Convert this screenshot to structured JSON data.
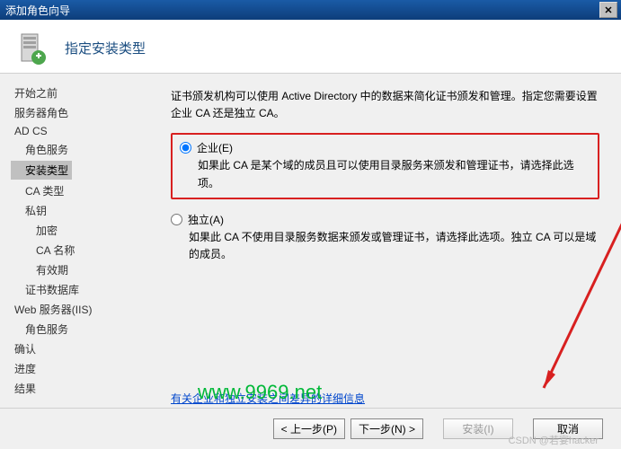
{
  "window": {
    "title": "添加角色向导"
  },
  "header": {
    "title": "指定安装类型"
  },
  "sidebar": {
    "items": [
      {
        "label": "开始之前",
        "indent": 0
      },
      {
        "label": "服务器角色",
        "indent": 0
      },
      {
        "label": "AD CS",
        "indent": 0
      },
      {
        "label": "角色服务",
        "indent": 1
      },
      {
        "label": "安装类型",
        "indent": 1,
        "selected": true
      },
      {
        "label": "CA 类型",
        "indent": 1
      },
      {
        "label": "私钥",
        "indent": 1
      },
      {
        "label": "加密",
        "indent": 2
      },
      {
        "label": "CA 名称",
        "indent": 2
      },
      {
        "label": "有效期",
        "indent": 2
      },
      {
        "label": "证书数据库",
        "indent": 1
      },
      {
        "label": "Web 服务器(IIS)",
        "indent": 0
      },
      {
        "label": "角色服务",
        "indent": 1
      },
      {
        "label": "确认",
        "indent": 0
      },
      {
        "label": "进度",
        "indent": 0
      },
      {
        "label": "结果",
        "indent": 0
      }
    ]
  },
  "content": {
    "intro": "证书颁发机构可以使用 Active Directory 中的数据来简化证书颁发和管理。指定您需要设置企业 CA 还是独立 CA。",
    "options": [
      {
        "title": "企业(E)",
        "desc": "如果此 CA 是某个域的成员且可以使用目录服务来颁发和管理证书，请选择此选项。",
        "checked": true,
        "highlighted": true
      },
      {
        "title": "独立(A)",
        "desc": "如果此 CA 不使用目录服务数据来颁发或管理证书，请选择此选项。独立 CA 可以是域的成员。",
        "checked": false,
        "highlighted": false
      }
    ],
    "link": "有关企业和独立安装之间差异的详细信息"
  },
  "buttons": {
    "prev": "< 上一步(P)",
    "next": "下一步(N) >",
    "install": "安装(I)",
    "cancel": "取消"
  },
  "watermark": "www.9969.net",
  "footer_watermark": "CSDN @若宴hacker"
}
